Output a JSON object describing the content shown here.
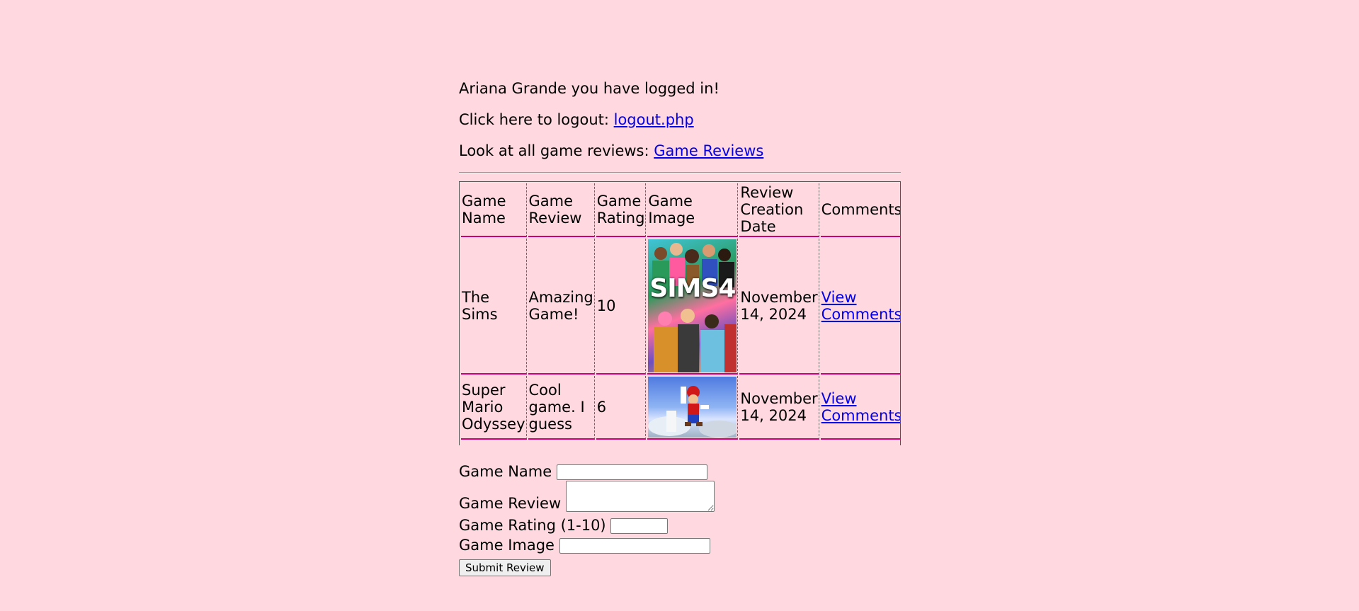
{
  "session": {
    "welcome": "Ariana Grande you have logged in!",
    "logout_prefix": "Click here to logout: ",
    "logout_link": "logout.php",
    "reviews_prefix": "Look at all game reviews: ",
    "reviews_link": "Game Reviews"
  },
  "table": {
    "headers": [
      "Game Name",
      "Game Review",
      "Game Rating",
      "Game Image",
      "Review Creation Date",
      "Comments"
    ],
    "rows": [
      {
        "name": "The Sims",
        "review": "Amazing Game!",
        "rating": "10",
        "image_alt": "SIMS4",
        "image_logo": "SIMS4",
        "date": "November 14, 2024",
        "comments_link": "View Comments"
      },
      {
        "name": "Super Mario Odyssey",
        "review": "Cool game. I guess",
        "rating": "6",
        "image_alt": "Super Mario Odyssey",
        "date": "November 14, 2024",
        "comments_link": "View Comments"
      }
    ]
  },
  "form": {
    "name_label": "Game Name",
    "name_value": "",
    "review_label": "Game Review",
    "review_value": "",
    "rating_label": "Game Rating (1-10)",
    "rating_value": "",
    "image_label": "Game Image",
    "image_value": "",
    "submit_label": "Submit Review"
  },
  "colors": {
    "background": "#ffd9df",
    "link": "#0000ee",
    "row_border": "#cc0077"
  }
}
